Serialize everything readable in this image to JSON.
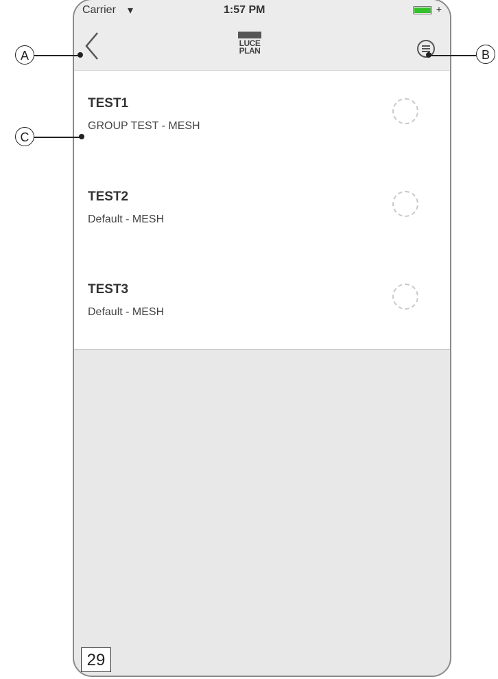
{
  "status_bar": {
    "carrier": "Carrier",
    "time": "1:57 PM",
    "battery_color": "#34c22c"
  },
  "nav": {
    "back_icon": "chevron-left-icon",
    "logo_top": "LUCE",
    "logo_bottom": "PLAN",
    "menu_icon": "menu-icon"
  },
  "items": [
    {
      "title": "TEST1",
      "subtitle": "GROUP TEST - MESH"
    },
    {
      "title": "TEST2",
      "subtitle": "Default - MESH"
    },
    {
      "title": "TEST3",
      "subtitle": "Default - MESH"
    }
  ],
  "page_number": "29",
  "callouts": {
    "a": "A",
    "b": "B",
    "c": "C"
  }
}
